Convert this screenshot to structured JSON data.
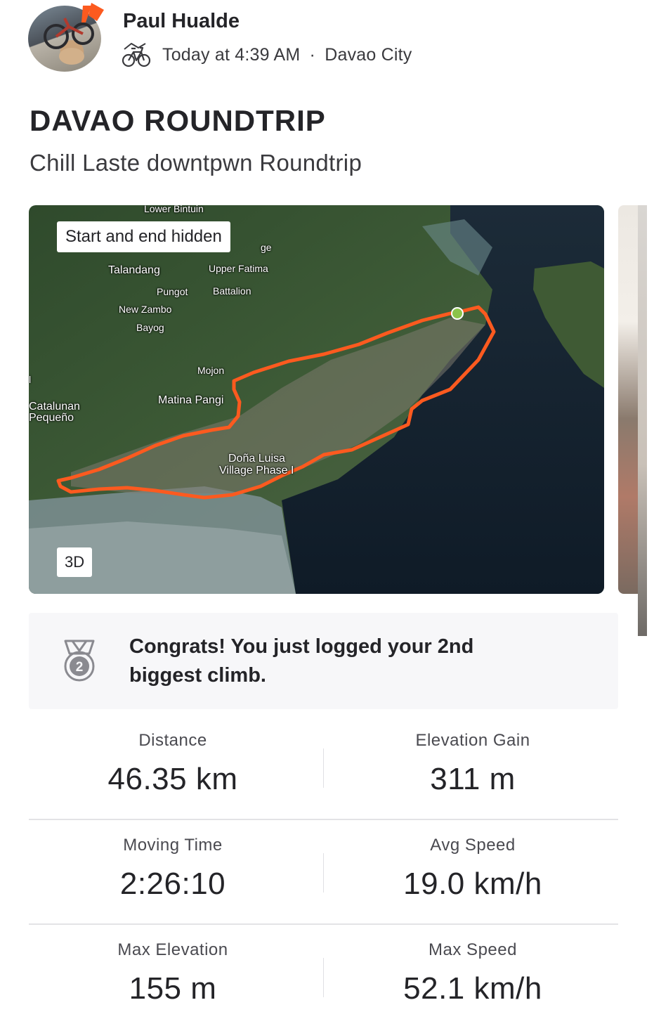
{
  "header": {
    "athlete_name": "Paul Hualde",
    "activity_icon": "bike-icon",
    "timestamp": "Today at 4:39 AM",
    "separator": "·",
    "location": "Davao City"
  },
  "activity": {
    "title": "DAVAO ROUNDTRIP",
    "description": "Chill Laste downtpwn Roundtrip"
  },
  "map": {
    "privacy_label": "Start and end hidden",
    "view_3d_label": "3D",
    "route_color": "#fc5a1f",
    "places": [
      "Lower Bintuin",
      "ge",
      "Talandang",
      "Upper Fatima",
      "Pungot",
      "Battalion",
      "New Zambo",
      "Bayog",
      "Mojon",
      "l",
      "Matina Pangi",
      "Catalunan",
      "Pequeño",
      "Doña Luisa",
      "Village Phase I"
    ]
  },
  "achievement": {
    "icon": "medal-icon",
    "rank": "2",
    "message": "Congrats! You just logged your 2nd biggest climb."
  },
  "stats": [
    {
      "label": "Distance",
      "value": "46.35 km"
    },
    {
      "label": "Elevation Gain",
      "value": "311 m"
    },
    {
      "label": "Moving Time",
      "value": "2:26:10"
    },
    {
      "label": "Avg Speed",
      "value": "19.0 km/h"
    },
    {
      "label": "Max Elevation",
      "value": "155 m"
    },
    {
      "label": "Max Speed",
      "value": "52.1 km/h"
    }
  ],
  "colors": {
    "brand": "#fc5a1f",
    "text_primary": "#242428",
    "panel_bg": "#f7f7f9"
  }
}
